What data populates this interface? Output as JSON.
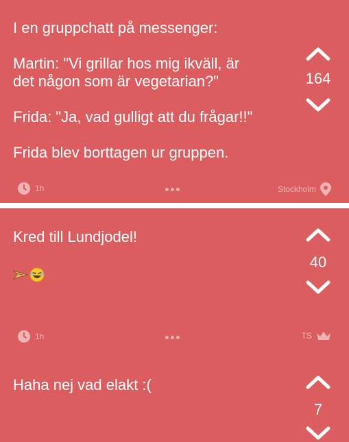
{
  "posts": [
    {
      "lines": [
        "I en gruppchatt på messenger:",
        "",
        "Martin: \"Vi grillar hos mig ikväll, är",
        "det någon som är vegetarian?\"",
        "",
        "Frida: \"Ja, vad gulligt att du frågar!!\"",
        "",
        "Frida blev borttagen ur gruppen."
      ],
      "score": "164",
      "time": "1h",
      "location": "Stockholm",
      "icons": {
        "up": "chevron-up-icon",
        "down": "chevron-down-icon",
        "time": "clock-icon",
        "more": "more-dots-icon",
        "location": "location-pin-icon"
      }
    },
    {
      "text": "Kred till Lundjodel!",
      "score": "40",
      "time": "1h",
      "author_tag": "TS",
      "icons": {
        "up": "chevron-up-icon",
        "down": "chevron-down-icon",
        "time": "clock-icon",
        "more": "more-dots-icon",
        "author": "crown-icon",
        "emoji1": "wood-plank-emoji",
        "emoji2": "laughing-emoji"
      }
    },
    {
      "text": "Haha nej vad elakt :(",
      "score": "7",
      "icons": {
        "up": "chevron-up-icon",
        "down": "chevron-down-icon"
      }
    }
  ],
  "colors": {
    "background": "#dc5d5f",
    "text": "#ffffff",
    "meta": "#f0b3b4",
    "divider": "#ffffff"
  }
}
